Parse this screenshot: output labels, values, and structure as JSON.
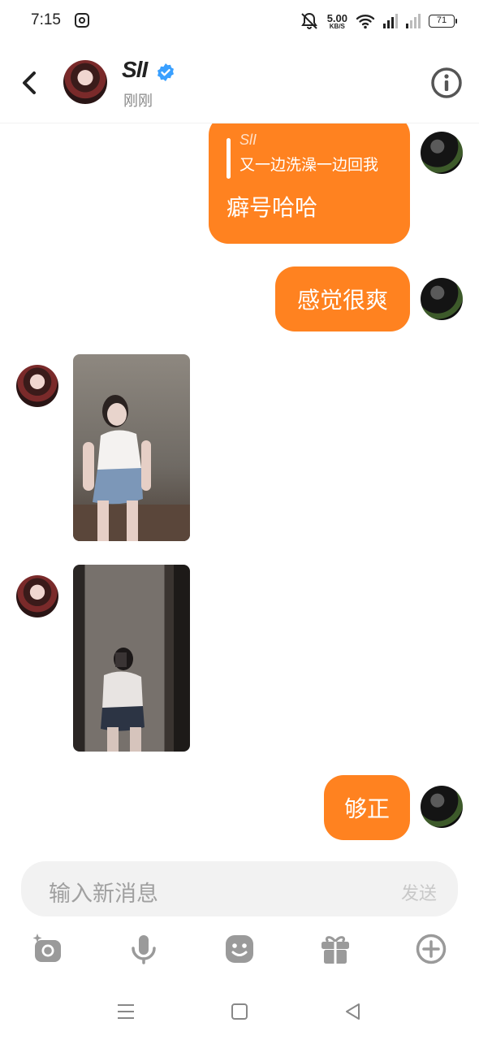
{
  "status_bar": {
    "time": "7:15",
    "net_speed_value": "5.00",
    "net_speed_unit": "KB/S",
    "battery": "71"
  },
  "header": {
    "name": "SlI",
    "status": "刚刚",
    "verified_color": "#3aa0ff"
  },
  "messages": [
    {
      "type": "quote-reply",
      "side": "me",
      "quote_name": "SlI",
      "quote_text": "又一边洗澡一边回我",
      "text": "癖号哈哈"
    },
    {
      "type": "text",
      "side": "me",
      "text": "感觉很爽"
    },
    {
      "type": "image",
      "side": "her"
    },
    {
      "type": "image",
      "side": "her"
    },
    {
      "type": "text",
      "side": "me",
      "text": "够正"
    }
  ],
  "composer": {
    "placeholder": "输入新消息",
    "send_label": "发送"
  },
  "toolbar": {
    "icons": [
      "camera-icon",
      "microphone-icon",
      "emoji-icon",
      "gift-icon",
      "plus-icon"
    ]
  },
  "colors": {
    "bubble": "#ff8220",
    "input_bg": "#f2f2f2"
  }
}
